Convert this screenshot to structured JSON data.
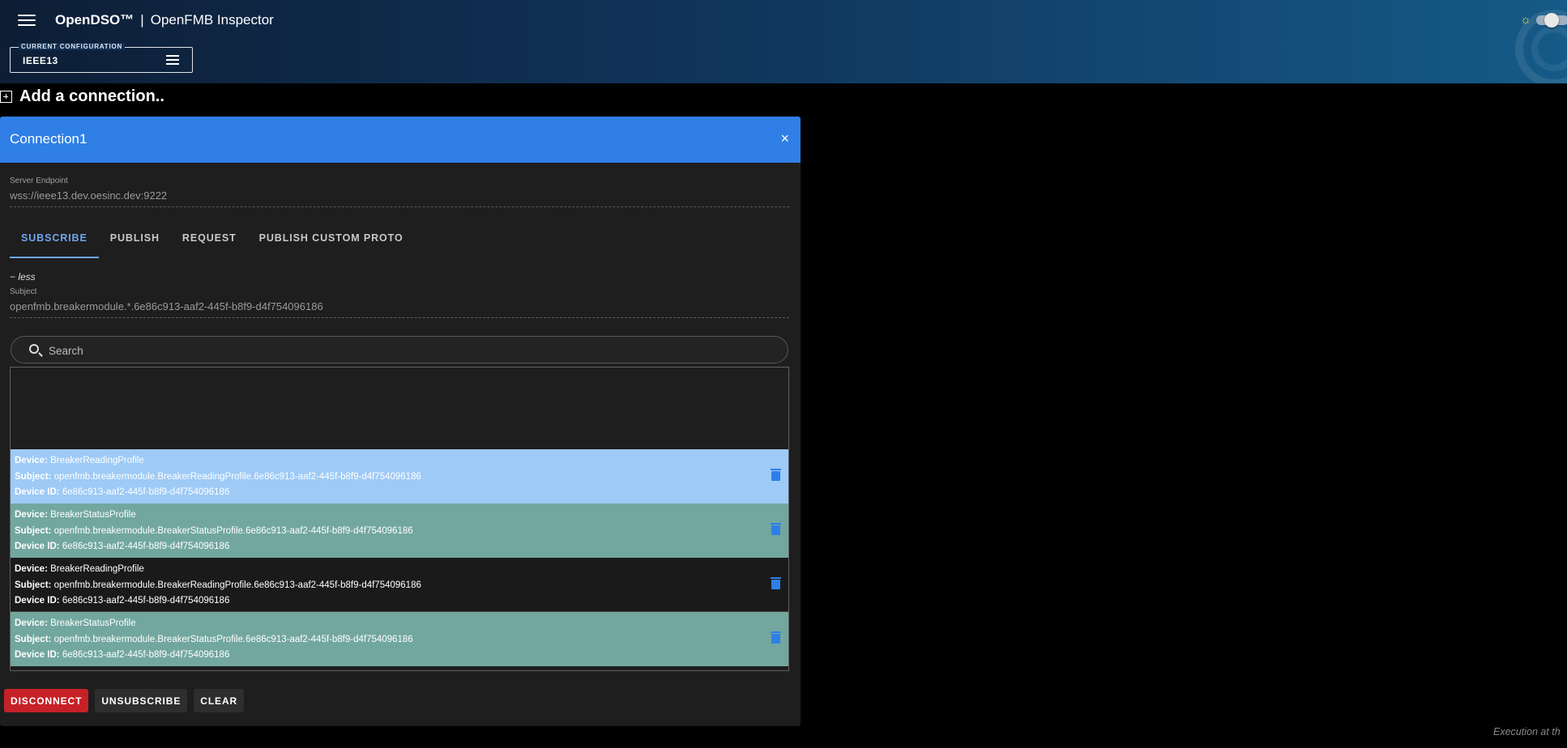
{
  "header": {
    "brand": "OpenDSO™",
    "separator": "|",
    "app_title": "OpenFMB Inspector",
    "config_label": "CURRENT CONFIGURATION",
    "config_value": "IEEE13"
  },
  "add_connection_label": "Add a connection..",
  "connection": {
    "title": "Connection1",
    "close_icon": "×",
    "endpoint_label": "Server Endpoint",
    "endpoint_value": "wss://ieee13.dev.oesinc.dev:9222",
    "tabs": [
      {
        "label": "SUBSCRIBE",
        "active": true
      },
      {
        "label": "PUBLISH"
      },
      {
        "label": "REQUEST"
      },
      {
        "label": "PUBLISH CUSTOM PROTO"
      }
    ],
    "less_toggle": "− less",
    "subject_label": "Subject",
    "subject_value": "openfmb.breakermodule.*.6e86c913-aaf2-445f-b8f9-d4f754096186",
    "search_placeholder": "Search",
    "field_labels": {
      "device": "Device:",
      "subject": "Subject:",
      "device_id": "Device ID:"
    },
    "messages": [
      {
        "device": "BreakerReadingProfile",
        "subject": "openfmb.breakermodule.BreakerReadingProfile.6e86c913-aaf2-445f-b8f9-d4f754096186",
        "device_id": "6e86c913-aaf2-445f-b8f9-d4f754096186",
        "state": "selected"
      },
      {
        "device": "BreakerStatusProfile",
        "subject": "openfmb.breakermodule.BreakerStatusProfile.6e86c913-aaf2-445f-b8f9-d4f754096186",
        "device_id": "6e86c913-aaf2-445f-b8f9-d4f754096186",
        "state": "teal"
      },
      {
        "device": "BreakerReadingProfile",
        "subject": "openfmb.breakermodule.BreakerReadingProfile.6e86c913-aaf2-445f-b8f9-d4f754096186",
        "device_id": "6e86c913-aaf2-445f-b8f9-d4f754096186",
        "state": "dark"
      },
      {
        "device": "BreakerStatusProfile",
        "subject": "openfmb.breakermodule.BreakerStatusProfile.6e86c913-aaf2-445f-b8f9-d4f754096186",
        "device_id": "6e86c913-aaf2-445f-b8f9-d4f754096186",
        "state": "teal"
      }
    ],
    "actions": {
      "disconnect": "DISCONNECT",
      "unsubscribe": "UNSUBSCRIBE",
      "clear": "CLEAR"
    }
  },
  "footer_note": "Execution at th",
  "colors": {
    "accent_blue": "#2f7fe6",
    "tab_active": "#6fa6ef",
    "selected_row": "#9ecaf6",
    "teal_row": "#72a79f",
    "danger": "#c62127"
  }
}
